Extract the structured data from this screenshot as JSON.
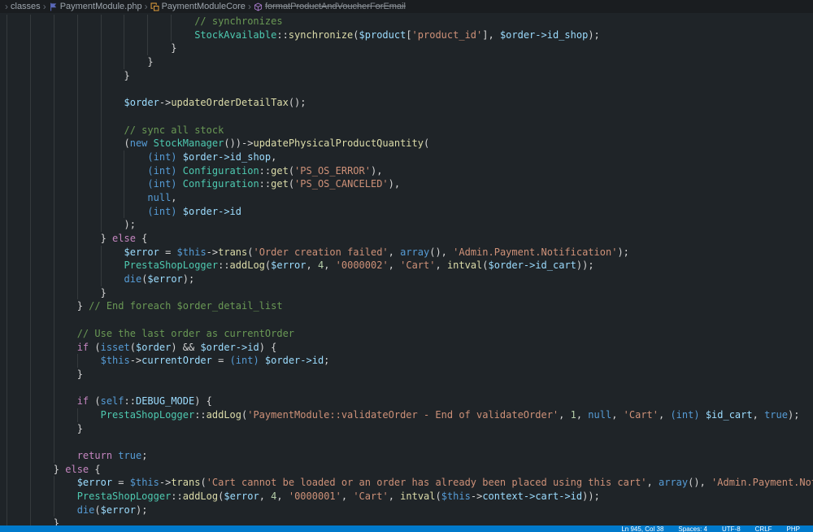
{
  "breadcrumb": {
    "separator": "›",
    "items": [
      {
        "label": "classes"
      },
      {
        "label": "PaymentModule.php",
        "icon": "php-file-icon"
      },
      {
        "label": "PaymentModuleCore",
        "icon": "class-icon"
      },
      {
        "label": "formatProductAndVoucherForEmail",
        "icon": "method-icon",
        "deprecated": true
      }
    ]
  },
  "status_bar": {
    "items": [
      "Ln 945, Col 38",
      "Spaces: 4",
      "UTF-8",
      "CRLF",
      "PHP"
    ]
  },
  "colors": {
    "df": "#d4d4d4",
    "cm": "#6a9955",
    "cls": "#4ec9b0",
    "fn": "#dcdcaa",
    "va": "#9cdcfe",
    "str": "#ce9178",
    "kw": "#569cd6",
    "ctl": "#c586c0",
    "num": "#b5cea8",
    "editor_bg": "#1f2428",
    "breadcrumb_bg": "#1a1d20",
    "status_bar_bg": "#007acc"
  },
  "editor": {
    "lines": [
      [
        {
          "c": "df",
          "t": "                                "
        },
        {
          "c": "cm",
          "t": "// synchronizes"
        }
      ],
      [
        {
          "c": "df",
          "t": "                                "
        },
        {
          "c": "cls",
          "t": "StockAvailable"
        },
        {
          "c": "df",
          "t": "::"
        },
        {
          "c": "fn",
          "t": "synchronize"
        },
        {
          "c": "df",
          "t": "("
        },
        {
          "c": "va",
          "t": "$product"
        },
        {
          "c": "df",
          "t": "["
        },
        {
          "c": "str",
          "t": "'product_id'"
        },
        {
          "c": "df",
          "t": "], "
        },
        {
          "c": "va",
          "t": "$order->id_shop"
        },
        {
          "c": "df",
          "t": ");"
        }
      ],
      [
        {
          "c": "df",
          "t": "                            }"
        }
      ],
      [
        {
          "c": "df",
          "t": "                        }"
        }
      ],
      [
        {
          "c": "df",
          "t": "                    }"
        }
      ],
      [],
      [
        {
          "c": "df",
          "t": "                    "
        },
        {
          "c": "va",
          "t": "$order"
        },
        {
          "c": "df",
          "t": "->"
        },
        {
          "c": "fn",
          "t": "updateOrderDetailTax"
        },
        {
          "c": "df",
          "t": "();"
        }
      ],
      [],
      [
        {
          "c": "df",
          "t": "                    "
        },
        {
          "c": "cm",
          "t": "// sync all stock"
        }
      ],
      [
        {
          "c": "df",
          "t": "                    ("
        },
        {
          "c": "kw",
          "t": "new"
        },
        {
          "c": "df",
          "t": " "
        },
        {
          "c": "cls",
          "t": "StockManager"
        },
        {
          "c": "df",
          "t": "())->"
        },
        {
          "c": "fn",
          "t": "updatePhysicalProductQuantity"
        },
        {
          "c": "df",
          "t": "("
        }
      ],
      [
        {
          "c": "df",
          "t": "                        "
        },
        {
          "c": "kw",
          "t": "(int)"
        },
        {
          "c": "df",
          "t": " "
        },
        {
          "c": "va",
          "t": "$order->id_shop"
        },
        {
          "c": "df",
          "t": ","
        }
      ],
      [
        {
          "c": "df",
          "t": "                        "
        },
        {
          "c": "kw",
          "t": "(int)"
        },
        {
          "c": "df",
          "t": " "
        },
        {
          "c": "cls",
          "t": "Configuration"
        },
        {
          "c": "df",
          "t": "::"
        },
        {
          "c": "fn",
          "t": "get"
        },
        {
          "c": "df",
          "t": "("
        },
        {
          "c": "str",
          "t": "'PS_OS_ERROR'"
        },
        {
          "c": "df",
          "t": "),"
        }
      ],
      [
        {
          "c": "df",
          "t": "                        "
        },
        {
          "c": "kw",
          "t": "(int)"
        },
        {
          "c": "df",
          "t": " "
        },
        {
          "c": "cls",
          "t": "Configuration"
        },
        {
          "c": "df",
          "t": "::"
        },
        {
          "c": "fn",
          "t": "get"
        },
        {
          "c": "df",
          "t": "("
        },
        {
          "c": "str",
          "t": "'PS_OS_CANCELED'"
        },
        {
          "c": "df",
          "t": "),"
        }
      ],
      [
        {
          "c": "df",
          "t": "                        "
        },
        {
          "c": "kw",
          "t": "null"
        },
        {
          "c": "df",
          "t": ","
        }
      ],
      [
        {
          "c": "df",
          "t": "                        "
        },
        {
          "c": "kw",
          "t": "(int)"
        },
        {
          "c": "df",
          "t": " "
        },
        {
          "c": "va",
          "t": "$order->id"
        }
      ],
      [
        {
          "c": "df",
          "t": "                    );"
        }
      ],
      [
        {
          "c": "df",
          "t": "                } "
        },
        {
          "c": "ctl",
          "t": "else"
        },
        {
          "c": "df",
          "t": " {"
        }
      ],
      [
        {
          "c": "df",
          "t": "                    "
        },
        {
          "c": "va",
          "t": "$error"
        },
        {
          "c": "df",
          "t": " = "
        },
        {
          "c": "kw",
          "t": "$this"
        },
        {
          "c": "df",
          "t": "->"
        },
        {
          "c": "fn",
          "t": "trans"
        },
        {
          "c": "df",
          "t": "("
        },
        {
          "c": "str",
          "t": "'Order creation failed'"
        },
        {
          "c": "df",
          "t": ", "
        },
        {
          "c": "kw",
          "t": "array"
        },
        {
          "c": "df",
          "t": "(), "
        },
        {
          "c": "str",
          "t": "'Admin.Payment.Notification'"
        },
        {
          "c": "df",
          "t": ");"
        }
      ],
      [
        {
          "c": "df",
          "t": "                    "
        },
        {
          "c": "cls",
          "t": "PrestaShopLogger"
        },
        {
          "c": "df",
          "t": "::"
        },
        {
          "c": "fn",
          "t": "addLog"
        },
        {
          "c": "df",
          "t": "("
        },
        {
          "c": "va",
          "t": "$error"
        },
        {
          "c": "df",
          "t": ", "
        },
        {
          "c": "num",
          "t": "4"
        },
        {
          "c": "df",
          "t": ", "
        },
        {
          "c": "str",
          "t": "'0000002'"
        },
        {
          "c": "df",
          "t": ", "
        },
        {
          "c": "str",
          "t": "'Cart'"
        },
        {
          "c": "df",
          "t": ", "
        },
        {
          "c": "fn",
          "t": "intval"
        },
        {
          "c": "df",
          "t": "("
        },
        {
          "c": "va",
          "t": "$order->id_cart"
        },
        {
          "c": "df",
          "t": "));"
        }
      ],
      [
        {
          "c": "df",
          "t": "                    "
        },
        {
          "c": "kw",
          "t": "die"
        },
        {
          "c": "df",
          "t": "("
        },
        {
          "c": "va",
          "t": "$error"
        },
        {
          "c": "df",
          "t": ");"
        }
      ],
      [
        {
          "c": "df",
          "t": "                }"
        }
      ],
      [
        {
          "c": "df",
          "t": "            } "
        },
        {
          "c": "cm",
          "t": "// End foreach $order_detail_list"
        }
      ],
      [],
      [
        {
          "c": "df",
          "t": "            "
        },
        {
          "c": "cm",
          "t": "// Use the last order as currentOrder"
        }
      ],
      [
        {
          "c": "df",
          "t": "            "
        },
        {
          "c": "ctl",
          "t": "if"
        },
        {
          "c": "df",
          "t": " ("
        },
        {
          "c": "kw",
          "t": "isset"
        },
        {
          "c": "df",
          "t": "("
        },
        {
          "c": "va",
          "t": "$order"
        },
        {
          "c": "df",
          "t": ") && "
        },
        {
          "c": "va",
          "t": "$order->id"
        },
        {
          "c": "df",
          "t": ") {"
        }
      ],
      [
        {
          "c": "df",
          "t": "                "
        },
        {
          "c": "kw",
          "t": "$this"
        },
        {
          "c": "df",
          "t": "->"
        },
        {
          "c": "va",
          "t": "currentOrder"
        },
        {
          "c": "df",
          "t": " = "
        },
        {
          "c": "kw",
          "t": "(int)"
        },
        {
          "c": "df",
          "t": " "
        },
        {
          "c": "va",
          "t": "$order->id"
        },
        {
          "c": "df",
          "t": ";"
        }
      ],
      [
        {
          "c": "df",
          "t": "            }"
        }
      ],
      [],
      [
        {
          "c": "df",
          "t": "            "
        },
        {
          "c": "ctl",
          "t": "if"
        },
        {
          "c": "df",
          "t": " ("
        },
        {
          "c": "kw",
          "t": "self"
        },
        {
          "c": "df",
          "t": "::"
        },
        {
          "c": "va",
          "t": "DEBUG_MODE"
        },
        {
          "c": "df",
          "t": ") {"
        }
      ],
      [
        {
          "c": "df",
          "t": "                "
        },
        {
          "c": "cls",
          "t": "PrestaShopLogger"
        },
        {
          "c": "df",
          "t": "::"
        },
        {
          "c": "fn",
          "t": "addLog"
        },
        {
          "c": "df",
          "t": "("
        },
        {
          "c": "str",
          "t": "'PaymentModule::validateOrder - End of validateOrder'"
        },
        {
          "c": "df",
          "t": ", "
        },
        {
          "c": "num",
          "t": "1"
        },
        {
          "c": "df",
          "t": ", "
        },
        {
          "c": "kw",
          "t": "null"
        },
        {
          "c": "df",
          "t": ", "
        },
        {
          "c": "str",
          "t": "'Cart'"
        },
        {
          "c": "df",
          "t": ", "
        },
        {
          "c": "kw",
          "t": "(int)"
        },
        {
          "c": "df",
          "t": " "
        },
        {
          "c": "va",
          "t": "$id_cart"
        },
        {
          "c": "df",
          "t": ", "
        },
        {
          "c": "kw",
          "t": "true"
        },
        {
          "c": "df",
          "t": ");"
        }
      ],
      [
        {
          "c": "df",
          "t": "            }"
        }
      ],
      [],
      [
        {
          "c": "df",
          "t": "            "
        },
        {
          "c": "ctl",
          "t": "return"
        },
        {
          "c": "df",
          "t": " "
        },
        {
          "c": "kw",
          "t": "true"
        },
        {
          "c": "df",
          "t": ";"
        }
      ],
      [
        {
          "c": "df",
          "t": "        } "
        },
        {
          "c": "ctl",
          "t": "else"
        },
        {
          "c": "df",
          "t": " {"
        }
      ],
      [
        {
          "c": "df",
          "t": "            "
        },
        {
          "c": "va",
          "t": "$error"
        },
        {
          "c": "df",
          "t": " = "
        },
        {
          "c": "kw",
          "t": "$this"
        },
        {
          "c": "df",
          "t": "->"
        },
        {
          "c": "fn",
          "t": "trans"
        },
        {
          "c": "df",
          "t": "("
        },
        {
          "c": "str",
          "t": "'Cart cannot be loaded or an order has already been placed using this cart'"
        },
        {
          "c": "df",
          "t": ", "
        },
        {
          "c": "kw",
          "t": "array"
        },
        {
          "c": "df",
          "t": "(), "
        },
        {
          "c": "str",
          "t": "'Admin.Payment.Notification'"
        },
        {
          "c": "df",
          "t": ");"
        }
      ],
      [
        {
          "c": "df",
          "t": "            "
        },
        {
          "c": "cls",
          "t": "PrestaShopLogger"
        },
        {
          "c": "df",
          "t": "::"
        },
        {
          "c": "fn",
          "t": "addLog"
        },
        {
          "c": "df",
          "t": "("
        },
        {
          "c": "va",
          "t": "$error"
        },
        {
          "c": "df",
          "t": ", "
        },
        {
          "c": "num",
          "t": "4"
        },
        {
          "c": "df",
          "t": ", "
        },
        {
          "c": "str",
          "t": "'0000001'"
        },
        {
          "c": "df",
          "t": ", "
        },
        {
          "c": "str",
          "t": "'Cart'"
        },
        {
          "c": "df",
          "t": ", "
        },
        {
          "c": "fn",
          "t": "intval"
        },
        {
          "c": "df",
          "t": "("
        },
        {
          "c": "kw",
          "t": "$this"
        },
        {
          "c": "df",
          "t": "->"
        },
        {
          "c": "va",
          "t": "context->cart->id"
        },
        {
          "c": "df",
          "t": "));"
        }
      ],
      [
        {
          "c": "df",
          "t": "            "
        },
        {
          "c": "kw",
          "t": "die"
        },
        {
          "c": "df",
          "t": "("
        },
        {
          "c": "va",
          "t": "$error"
        },
        {
          "c": "df",
          "t": ");"
        }
      ],
      [
        {
          "c": "df",
          "t": "        }"
        }
      ]
    ]
  }
}
